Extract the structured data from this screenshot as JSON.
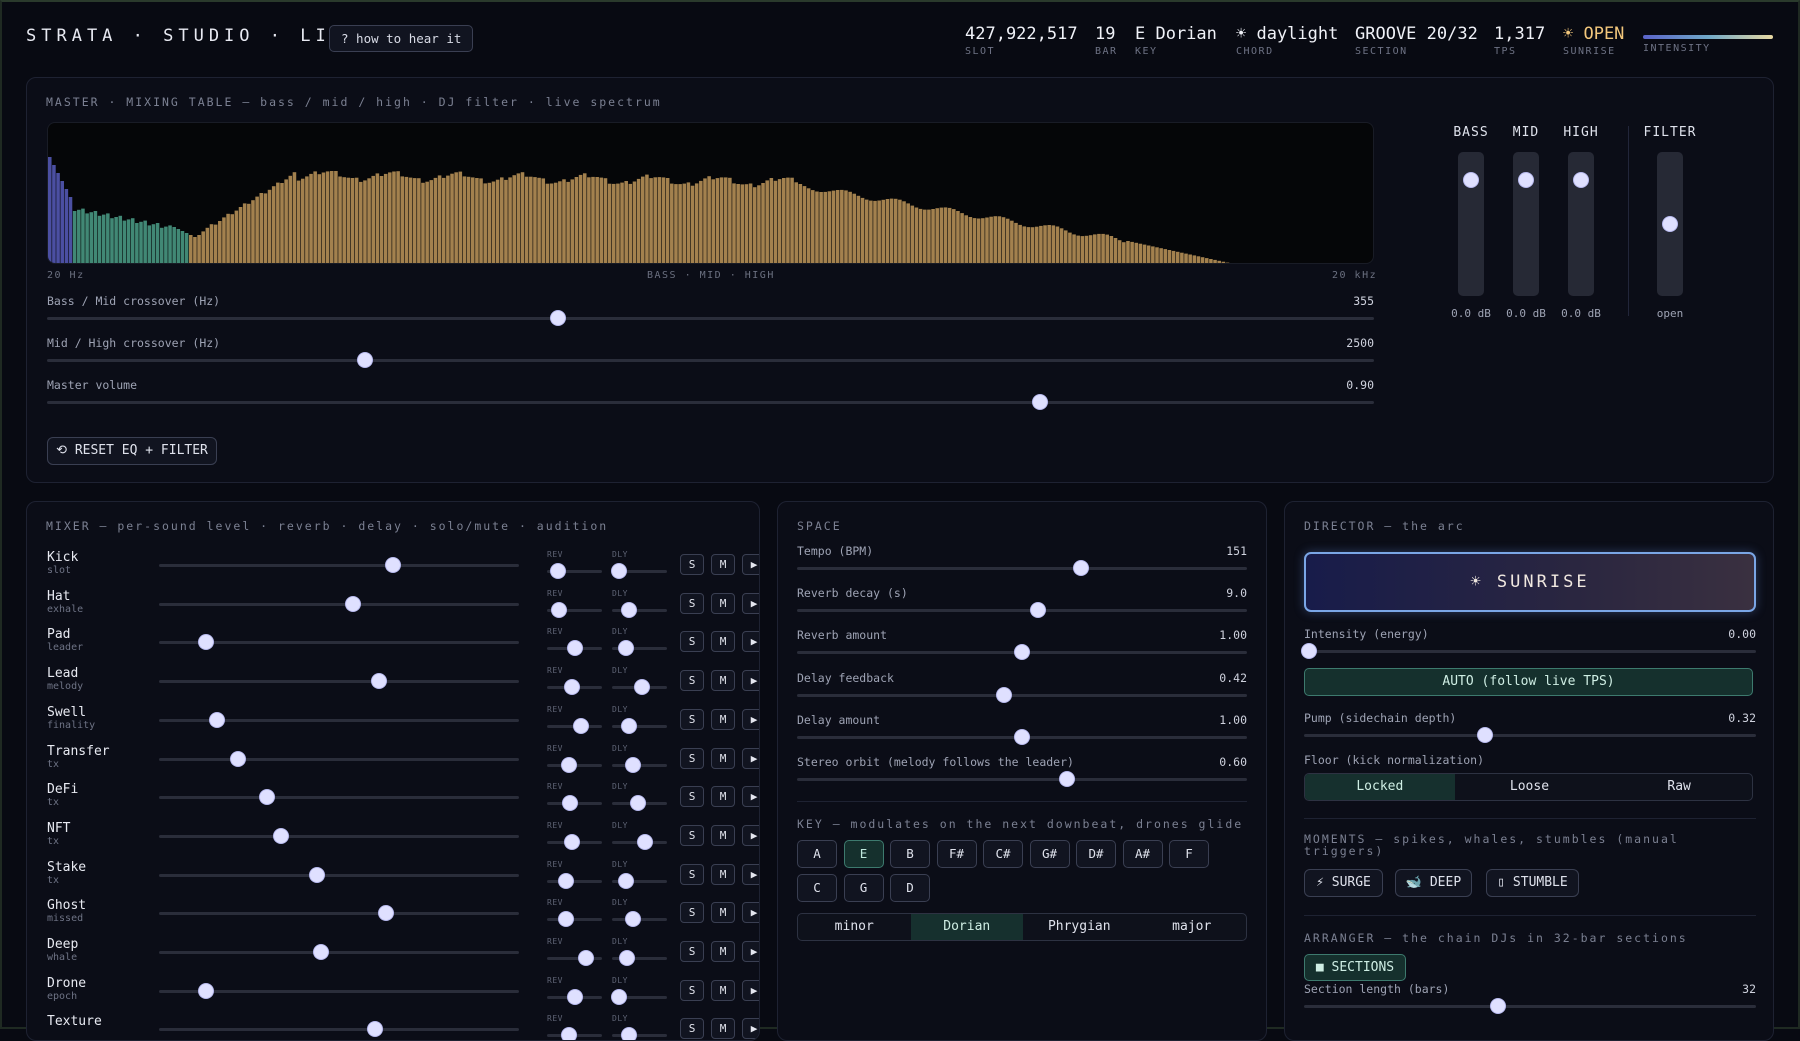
{
  "header": {
    "brand": "STRATA · STUDIO · LIVE",
    "howto": "? how to hear it",
    "stats": [
      {
        "value": "427,922,517",
        "label": "SLOT"
      },
      {
        "value": "19",
        "label": "BAR"
      },
      {
        "value": "E Dorian",
        "label": "KEY"
      },
      {
        "value": "☀ daylight",
        "label": "CHORD"
      },
      {
        "value": "GROOVE 20/32",
        "label": "SECTION"
      },
      {
        "value": "1,317",
        "label": "TPS"
      },
      {
        "value": "☀ OPEN",
        "label": "SUNRISE"
      },
      {
        "value": "",
        "label": "INTENSITY"
      }
    ]
  },
  "master": {
    "title": "MASTER · MIXING TABLE — bass / mid / high · DJ filter · live spectrum",
    "spec_left": "20 Hz",
    "spec_mid": "BASS · MID · HIGH",
    "spec_right": "20 kHz",
    "sliders": [
      {
        "label": "Bass / Mid crossover (Hz)",
        "value": "355",
        "pos": 0.385
      },
      {
        "label": "Mid / High crossover (Hz)",
        "value": "2500",
        "pos": 0.24
      },
      {
        "label": "Master volume",
        "value": "0.90",
        "pos": 0.748
      }
    ],
    "reset": "⟲ RESET EQ + FILTER",
    "faders": [
      {
        "label": "BASS",
        "value": "0.0 dB",
        "level": 0.84
      },
      {
        "label": "MID",
        "value": "0.0 dB",
        "level": 0.84
      },
      {
        "label": "HIGH",
        "value": "0.0 dB",
        "level": 0.84
      },
      {
        "label": "FILTER",
        "value": "open",
        "level": 0.5
      }
    ]
  },
  "mixer": {
    "title": "MIXER — per-sound level · reverb · delay · solo/mute · audition",
    "rev_label": "REV",
    "dly_label": "DLY",
    "solo": "S",
    "mute": "M",
    "play": "▶",
    "rows": [
      {
        "name": "Kick",
        "sub": "slot",
        "level": 0.65,
        "rev": 0.2,
        "dly": 0.12
      },
      {
        "name": "Hat",
        "sub": "exhale",
        "level": 0.54,
        "rev": 0.22,
        "dly": 0.3
      },
      {
        "name": "Pad",
        "sub": "leader",
        "level": 0.13,
        "rev": 0.5,
        "dly": 0.26
      },
      {
        "name": "Lead",
        "sub": "melody",
        "level": 0.61,
        "rev": 0.45,
        "dly": 0.55
      },
      {
        "name": "Swell",
        "sub": "finality",
        "level": 0.16,
        "rev": 0.62,
        "dly": 0.3
      },
      {
        "name": "Transfer",
        "sub": "tx",
        "level": 0.22,
        "rev": 0.4,
        "dly": 0.38
      },
      {
        "name": "DeFi",
        "sub": "tx",
        "level": 0.3,
        "rev": 0.42,
        "dly": 0.48
      },
      {
        "name": "NFT",
        "sub": "tx",
        "level": 0.34,
        "rev": 0.45,
        "dly": 0.6
      },
      {
        "name": "Stake",
        "sub": "tx",
        "level": 0.44,
        "rev": 0.35,
        "dly": 0.25
      },
      {
        "name": "Ghost",
        "sub": "missed",
        "level": 0.63,
        "rev": 0.35,
        "dly": 0.38
      },
      {
        "name": "Deep",
        "sub": "whale",
        "level": 0.45,
        "rev": 0.7,
        "dly": 0.28
      },
      {
        "name": "Drone",
        "sub": "epoch",
        "level": 0.13,
        "rev": 0.5,
        "dly": 0.12
      },
      {
        "name": "Texture",
        "sub": "",
        "level": 0.6,
        "rev": 0.4,
        "dly": 0.3
      }
    ]
  },
  "space": {
    "title": "SPACE",
    "sliders": [
      {
        "label": "Tempo (BPM)",
        "value": "151",
        "pos": 0.63
      },
      {
        "label": "Reverb decay (s)",
        "value": "9.0",
        "pos": 0.535
      },
      {
        "label": "Reverb amount",
        "value": "1.00",
        "pos": 0.5
      },
      {
        "label": "Delay feedback",
        "value": "0.42",
        "pos": 0.46
      },
      {
        "label": "Delay amount",
        "value": "1.00",
        "pos": 0.5
      },
      {
        "label": "Stereo orbit (melody follows the leader)",
        "value": "0.60",
        "pos": 0.6
      }
    ],
    "key_title": "KEY — modulates on the next downbeat, drones glide",
    "keys": [
      "A",
      "E",
      "B",
      "F#",
      "C#",
      "G#",
      "D#",
      "A#",
      "F",
      "C",
      "G",
      "D"
    ],
    "selected_key": "E",
    "modes": [
      "minor",
      "Dorian",
      "Phrygian",
      "major"
    ],
    "selected_mode": "Dorian"
  },
  "director": {
    "title": "DIRECTOR — the arc",
    "sunrise": "☀ SUNRISE",
    "intensity_label": "Intensity (energy)",
    "intensity_value": "0.00",
    "intensity_pos": 0.01,
    "auto": "AUTO (follow live TPS)",
    "pump_label": "Pump (sidechain depth)",
    "pump_value": "0.32",
    "pump_pos": 0.4,
    "floor_label": "Floor (kick normalization)",
    "floor_options": [
      "Locked",
      "Loose",
      "Raw"
    ],
    "floor_selected": "Locked",
    "moments_title": "MOMENTS — spikes, whales, stumbles (manual triggers)",
    "moments": [
      "⚡ SURGE",
      "🐋 DEEP",
      "▯ STUMBLE"
    ],
    "arranger_title": "ARRANGER — the chain DJs in 32-bar sections",
    "sections_btn": "■ SECTIONS",
    "section_len_label": "Section length (bars)",
    "section_len_value": "32",
    "section_len_pos": 0.43
  },
  "colors": {
    "accent": "#dfe0ff",
    "bass": "#5c5fc4",
    "mid": "#4fa58d",
    "high": "#c79c5e",
    "open": "#f2c77c"
  }
}
